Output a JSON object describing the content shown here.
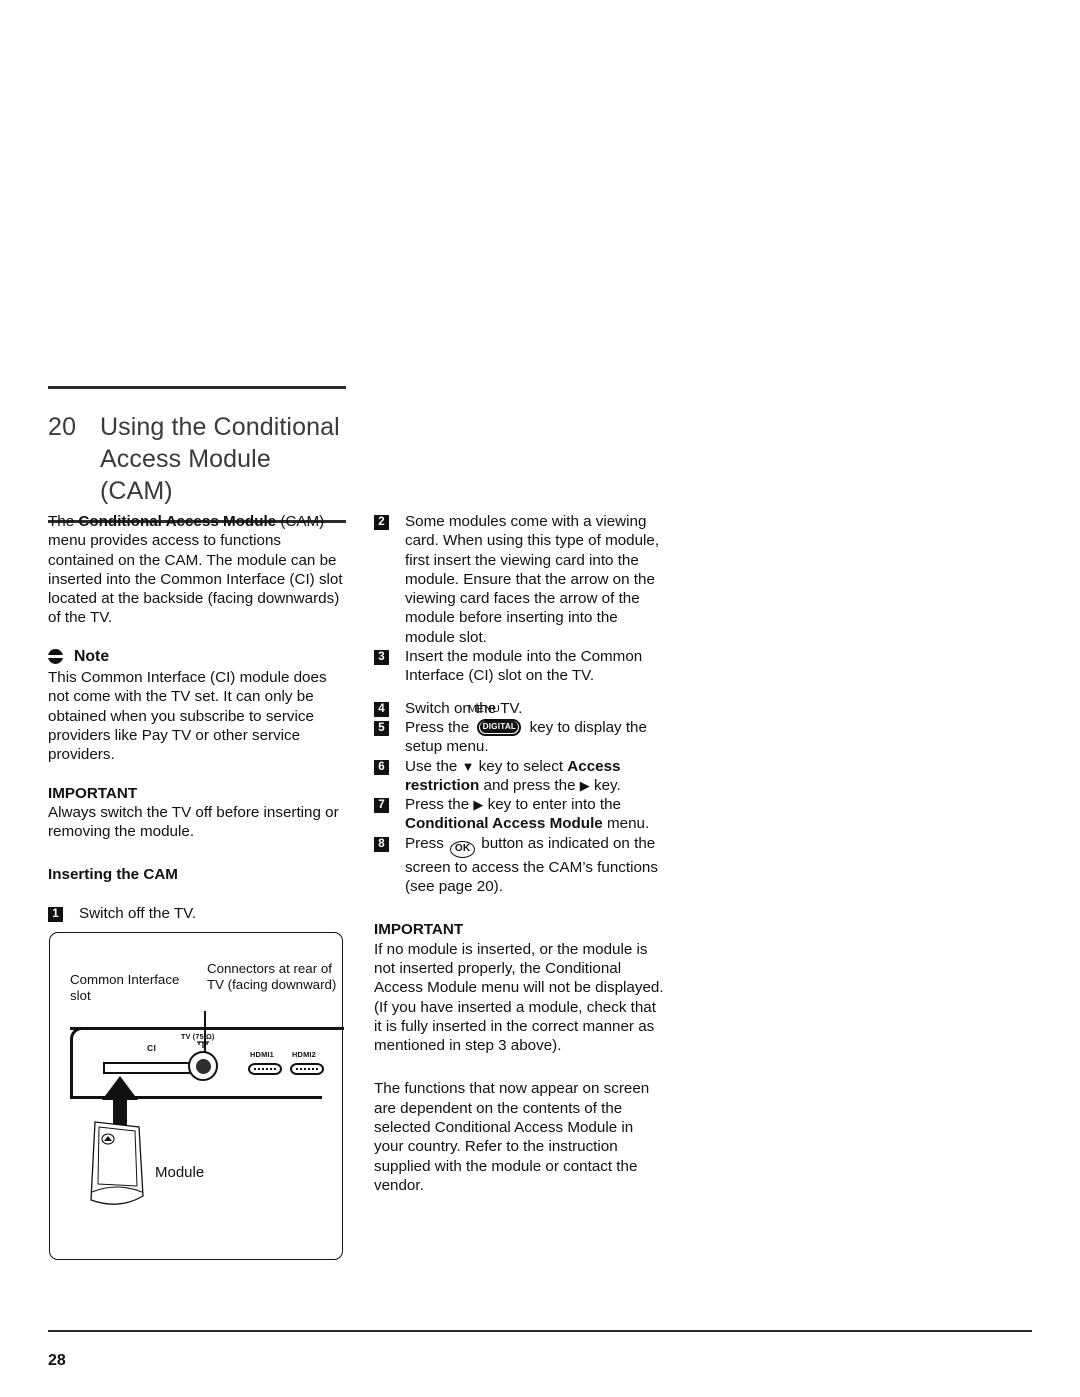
{
  "document": {
    "chapter_number": "20",
    "chapter_title_line1": "Using the Conditional",
    "chapter_title_line2": "Access Module (CAM)",
    "page_number": "28"
  },
  "left_column": {
    "intro": {
      "lead": "The ",
      "bold": "Conditional Access Module",
      "rest": " (CAM) menu provides access to functions contained on the CAM.  The module can be inserted into the Common Interface (CI) slot located at the backside (facing downwards) of the TV."
    },
    "note": {
      "icon": "note-icon",
      "label": "Note",
      "body": "This Common Interface (CI) module does not come with the TV set. It  can only be obtained when you subscribe to service providers like Pay TV or other service providers."
    },
    "important": {
      "heading": "IMPORTANT",
      "body": "Always switch the TV off before inserting or removing the module."
    },
    "section_heading": "Inserting the CAM",
    "step1": {
      "num": "1",
      "text": "Switch off the TV."
    }
  },
  "diagram": {
    "label_common_interface": "Common Interface slot",
    "label_connectors": "Connectors at rear of TV (facing downward)",
    "label_ci_port": "CI",
    "label_tv_jack": "TV (75 Ω)",
    "label_hdmi1": "HDMI1",
    "label_hdmi2": "HDMI2",
    "label_module": "Module"
  },
  "right_column": {
    "step2": {
      "num": "2",
      "text": "Some modules come with a viewing card. When using this type of module, first insert the viewing card into the module. Ensure that the arrow on the viewing card faces the arrow of the module before inserting into the module slot."
    },
    "step3": {
      "num": "3",
      "text": "Insert the module into the Common Interface (CI) slot on the TV."
    },
    "step4": {
      "num": "4",
      "text": "Switch on the TV."
    },
    "step5": {
      "num": "5",
      "prefix": "Press the ",
      "key_menu_label": "MENU",
      "key_digital_label": "DIGITAL",
      "suffix": " key to display the setup menu."
    },
    "step6": {
      "num": "6",
      "prefix": "Use the ",
      "down_arrow": "▼",
      "mid": " key to select ",
      "bold": "Access restriction",
      "mid2": " and press the ",
      "right_arrow": "▶",
      "suffix": " key."
    },
    "step7": {
      "num": "7",
      "prefix": "Press the ",
      "right_arrow": "▶",
      "mid": " key to enter into the ",
      "bold": "Conditional Access Module",
      "suffix": " menu."
    },
    "step8": {
      "num": "8",
      "prefix": "Press ",
      "key_ok_label": "OK",
      "suffix": " button as indicated on the screen to access the CAM’s functions (see page 20)."
    },
    "important": {
      "heading": "IMPORTANT",
      "body": "If no module is inserted, or the module is not inserted properly, the Conditional Access Module menu will not be displayed. (If you have inserted a module, check that it is fully inserted in the correct manner as mentioned in step 3 above)."
    },
    "closing": "The functions that now appear on screen are dependent on the contents of the selected Conditional Access Module in your country. Refer to the instruction supplied with the module or contact the vendor."
  }
}
